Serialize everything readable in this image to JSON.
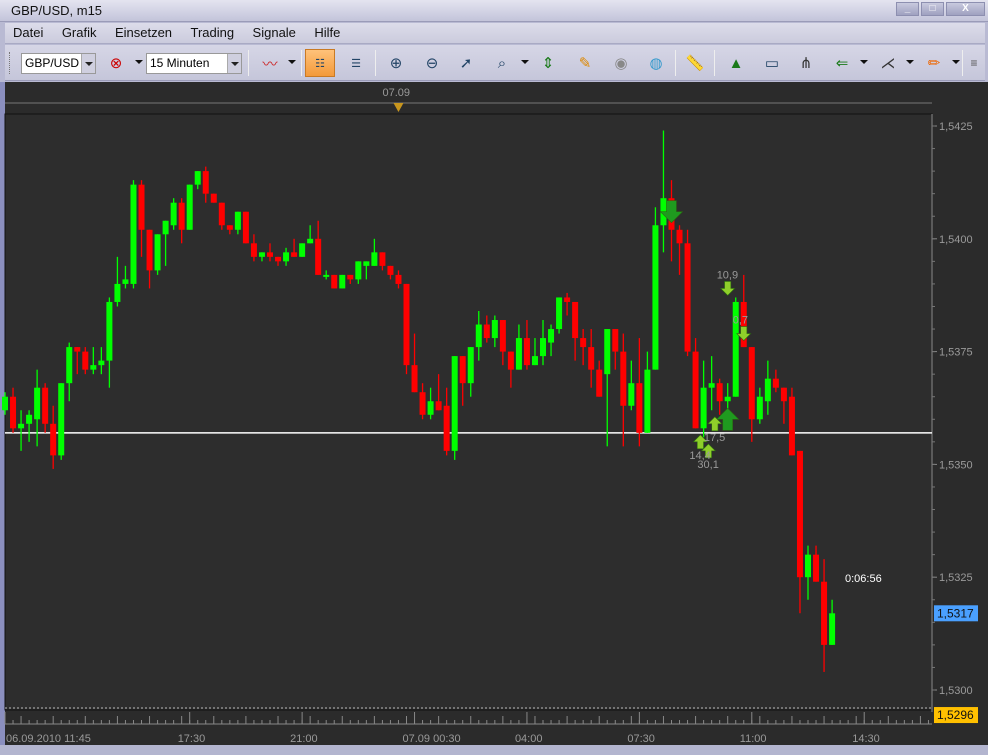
{
  "window": {
    "title": "GBP/USD, m15",
    "minimize": "_",
    "maximize": "□",
    "close": "X"
  },
  "menu": [
    "Datei",
    "Grafik",
    "Einsetzen",
    "Trading",
    "Signale",
    "Hilfe"
  ],
  "toolbar": {
    "symbol": "GBP/USD",
    "timeframe": "15 Minuten"
  },
  "colors": {
    "up": "#00ff00",
    "down": "#ff0000",
    "background": "#2d2d2d",
    "bid_label": "#4aa0ff",
    "low_label": "#ffc000"
  },
  "chart_data": {
    "type": "candlestick",
    "symbol": "GBP/USD",
    "timeframe": "m15",
    "top_date_marker": "07.09",
    "price_ticks": [
      "1,5425",
      "1,5400",
      "1,5375",
      "1,5350",
      "1,5325",
      "1,5300"
    ],
    "price_tick_values": [
      1.5425,
      1.54,
      1.5375,
      1.535,
      1.5325,
      1.53
    ],
    "ylim": [
      1.529,
      1.543
    ],
    "current_price": 1.5317,
    "current_price_label": "1,5317",
    "low_line": 1.5296,
    "low_line_label": "1,5296",
    "level_line": 1.5357,
    "countdown": "0:06:56",
    "time_labels": [
      {
        "label": "06.09.2010 11:45",
        "bar": 0
      },
      {
        "label": "17:30",
        "bar": 23
      },
      {
        "label": "21:00",
        "bar": 37
      },
      {
        "label": "07.09 00:30",
        "bar": 51
      },
      {
        "label": "04:00",
        "bar": 65
      },
      {
        "label": "07:30",
        "bar": 79
      },
      {
        "label": "11:00",
        "bar": 93
      },
      {
        "label": "14:30",
        "bar": 107
      }
    ],
    "date_marker_bar": 49,
    "ohlc": [
      [
        1.5362,
        1.5366,
        1.5361,
        1.5365
      ],
      [
        1.5365,
        1.5367,
        1.5357,
        1.5358
      ],
      [
        1.5358,
        1.5362,
        1.5353,
        1.5359
      ],
      [
        1.5359,
        1.5362,
        1.5355,
        1.5361
      ],
      [
        1.536,
        1.5371,
        1.5354,
        1.5367
      ],
      [
        1.5367,
        1.5368,
        1.5357,
        1.5359
      ],
      [
        1.5359,
        1.5363,
        1.5349,
        1.5352
      ],
      [
        1.5352,
        1.5368,
        1.5351,
        1.5368
      ],
      [
        1.5368,
        1.5377,
        1.5364,
        1.5376
      ],
      [
        1.5376,
        1.5376,
        1.537,
        1.5375
      ],
      [
        1.5375,
        1.5376,
        1.537,
        1.5371
      ],
      [
        1.5371,
        1.5376,
        1.537,
        1.5372
      ],
      [
        1.5372,
        1.5376,
        1.537,
        1.5373
      ],
      [
        1.5373,
        1.5387,
        1.5367,
        1.5386
      ],
      [
        1.5386,
        1.5396,
        1.5385,
        1.539
      ],
      [
        1.539,
        1.5394,
        1.5389,
        1.5391
      ],
      [
        1.539,
        1.5413,
        1.5389,
        1.5412
      ],
      [
        1.5412,
        1.5413,
        1.5396,
        1.5402
      ],
      [
        1.5402,
        1.5402,
        1.5389,
        1.5393
      ],
      [
        1.5393,
        1.5401,
        1.5392,
        1.5401
      ],
      [
        1.5401,
        1.5404,
        1.5394,
        1.5404
      ],
      [
        1.5403,
        1.5409,
        1.5402,
        1.5408
      ],
      [
        1.5408,
        1.5409,
        1.5399,
        1.5402
      ],
      [
        1.5402,
        1.5412,
        1.5402,
        1.5412
      ],
      [
        1.5412,
        1.5415,
        1.5411,
        1.5415
      ],
      [
        1.5415,
        1.5416,
        1.5408,
        1.541
      ],
      [
        1.541,
        1.541,
        1.5408,
        1.5408
      ],
      [
        1.5408,
        1.5408,
        1.5402,
        1.5403
      ],
      [
        1.5403,
        1.5403,
        1.5401,
        1.5402
      ],
      [
        1.5402,
        1.5406,
        1.5401,
        1.5406
      ],
      [
        1.5406,
        1.5406,
        1.5399,
        1.5399
      ],
      [
        1.5399,
        1.5401,
        1.5395,
        1.5396
      ],
      [
        1.5396,
        1.5397,
        1.5395,
        1.5397
      ],
      [
        1.5397,
        1.5399,
        1.5395,
        1.5396
      ],
      [
        1.5396,
        1.5396,
        1.5394,
        1.5395
      ],
      [
        1.5395,
        1.5398,
        1.5394,
        1.5397
      ],
      [
        1.5397,
        1.54,
        1.5396,
        1.5396
      ],
      [
        1.5396,
        1.5399,
        1.5396,
        1.5399
      ],
      [
        1.5399,
        1.5403,
        1.5399,
        1.54
      ],
      [
        1.54,
        1.5404,
        1.5392,
        1.5392
      ],
      [
        1.5392,
        1.5393,
        1.5391,
        1.5392
      ],
      [
        1.5392,
        1.5392,
        1.5389,
        1.5389
      ],
      [
        1.5389,
        1.5392,
        1.5389,
        1.5392
      ],
      [
        1.5392,
        1.5392,
        1.539,
        1.5391
      ],
      [
        1.5391,
        1.5395,
        1.539,
        1.5395
      ],
      [
        1.5394,
        1.5395,
        1.5391,
        1.5395
      ],
      [
        1.5394,
        1.54,
        1.5394,
        1.5397
      ],
      [
        1.5397,
        1.5397,
        1.5393,
        1.5394
      ],
      [
        1.5394,
        1.5394,
        1.5391,
        1.5392
      ],
      [
        1.5392,
        1.5393,
        1.5389,
        1.539
      ],
      [
        1.539,
        1.539,
        1.537,
        1.5372
      ],
      [
        1.5372,
        1.5379,
        1.5366,
        1.5366
      ],
      [
        1.5366,
        1.5368,
        1.536,
        1.5361
      ],
      [
        1.5361,
        1.5367,
        1.536,
        1.5364
      ],
      [
        1.5364,
        1.537,
        1.5362,
        1.5362
      ],
      [
        1.5363,
        1.5367,
        1.5352,
        1.5353
      ],
      [
        1.5353,
        1.5374,
        1.5351,
        1.5374
      ],
      [
        1.5374,
        1.5374,
        1.5363,
        1.5368
      ],
      [
        1.5368,
        1.5376,
        1.5365,
        1.5376
      ],
      [
        1.5376,
        1.5384,
        1.5373,
        1.5381
      ],
      [
        1.5381,
        1.5383,
        1.5377,
        1.5378
      ],
      [
        1.5378,
        1.5383,
        1.5376,
        1.5382
      ],
      [
        1.5382,
        1.5382,
        1.5372,
        1.5375
      ],
      [
        1.5375,
        1.5375,
        1.5367,
        1.5371
      ],
      [
        1.5371,
        1.5381,
        1.5371,
        1.5378
      ],
      [
        1.5378,
        1.5382,
        1.5371,
        1.5372
      ],
      [
        1.5372,
        1.5378,
        1.5372,
        1.5374
      ],
      [
        1.5374,
        1.5382,
        1.5372,
        1.5378
      ],
      [
        1.5377,
        1.5381,
        1.5374,
        1.538
      ],
      [
        1.538,
        1.5387,
        1.5379,
        1.5387
      ],
      [
        1.5387,
        1.5388,
        1.5383,
        1.5386
      ],
      [
        1.5386,
        1.5386,
        1.5373,
        1.5378
      ],
      [
        1.5378,
        1.538,
        1.5372,
        1.5376
      ],
      [
        1.5376,
        1.538,
        1.5367,
        1.5371
      ],
      [
        1.5371,
        1.5373,
        1.5365,
        1.5365
      ],
      [
        1.537,
        1.538,
        1.5354,
        1.538
      ],
      [
        1.538,
        1.538,
        1.5371,
        1.5375
      ],
      [
        1.5375,
        1.5379,
        1.5354,
        1.5363
      ],
      [
        1.5363,
        1.5373,
        1.5362,
        1.5368
      ],
      [
        1.5368,
        1.5378,
        1.5354,
        1.5357
      ],
      [
        1.5357,
        1.5375,
        1.5357,
        1.5371
      ],
      [
        1.5371,
        1.5407,
        1.5371,
        1.5403
      ],
      [
        1.5403,
        1.5424,
        1.5397,
        1.5409
      ],
      [
        1.5409,
        1.5413,
        1.5395,
        1.5402
      ],
      [
        1.5402,
        1.5403,
        1.5392,
        1.5399
      ],
      [
        1.5399,
        1.5402,
        1.5374,
        1.5375
      ],
      [
        1.5375,
        1.5378,
        1.5358,
        1.5358
      ],
      [
        1.5358,
        1.5373,
        1.5356,
        1.5367
      ],
      [
        1.5367,
        1.5374,
        1.5362,
        1.5368
      ],
      [
        1.5368,
        1.5369,
        1.5361,
        1.5364
      ],
      [
        1.5364,
        1.5368,
        1.5359,
        1.5365
      ],
      [
        1.5365,
        1.5387,
        1.5365,
        1.5386
      ],
      [
        1.5386,
        1.5392,
        1.5376,
        1.5376
      ],
      [
        1.5376,
        1.5376,
        1.5355,
        1.536
      ],
      [
        1.536,
        1.5367,
        1.5359,
        1.5365
      ],
      [
        1.5364,
        1.5373,
        1.5361,
        1.5369
      ],
      [
        1.5369,
        1.5371,
        1.5366,
        1.5367
      ],
      [
        1.5367,
        1.5367,
        1.5359,
        1.5364
      ],
      [
        1.5365,
        1.5367,
        1.5352,
        1.5352
      ],
      [
        1.5353,
        1.5353,
        1.5317,
        1.5325
      ],
      [
        1.5325,
        1.5332,
        1.532,
        1.533
      ],
      [
        1.533,
        1.5332,
        1.5324,
        1.5324
      ],
      [
        1.5324,
        1.5329,
        1.5304,
        1.531
      ],
      [
        1.531,
        1.532,
        1.531,
        1.5317
      ]
    ],
    "signals": [
      {
        "dir": "sell",
        "size": "big",
        "bar": 83,
        "price": 1.5406,
        "label": ""
      },
      {
        "dir": "sell",
        "size": "small",
        "bar": 90,
        "price": 1.5389,
        "label": "10,9"
      },
      {
        "dir": "sell",
        "size": "small",
        "bar": 92,
        "price": 1.5379,
        "label": "0,7"
      },
      {
        "dir": "buy",
        "size": "big",
        "bar": 90,
        "price": 1.536,
        "label": ""
      },
      {
        "dir": "buy",
        "size": "small",
        "bar": 88.4,
        "price": 1.5359,
        "label": "17,5"
      },
      {
        "dir": "buy",
        "size": "small",
        "bar": 86.6,
        "price": 1.5355,
        "label": "14,4"
      },
      {
        "dir": "buy",
        "size": "small",
        "bar": 87.6,
        "price": 1.5353,
        "label": "30,1"
      }
    ]
  }
}
